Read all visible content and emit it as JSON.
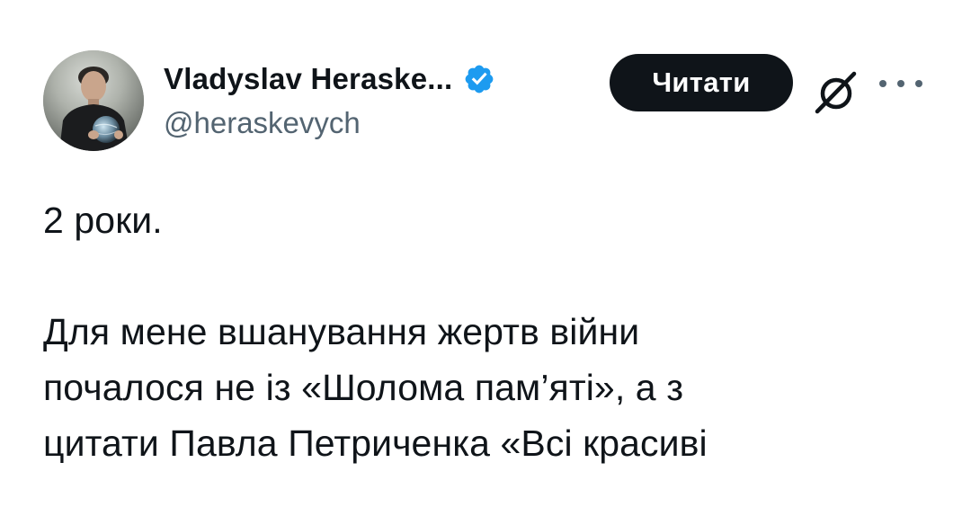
{
  "author": {
    "display_name": "Vladyslav Heraske...",
    "handle": "@heraskevych",
    "verified": true
  },
  "actions": {
    "follow_label": "Читати"
  },
  "tweet": {
    "paragraph_1": "2 роки.",
    "paragraph_2": "Для мене вшанування жертв війни\nпочалося не із «Шолома пам’яті», а з\nцитати Павла Петриченка «Всі красиві"
  },
  "icons": {
    "verified": "verified-badge-icon",
    "grok": "grok-icon",
    "more": "more-options-icon"
  },
  "colors": {
    "text_primary": "#0f1419",
    "text_secondary": "#536471",
    "verified_blue": "#1d9bf0",
    "button_bg": "#0f1419",
    "button_text": "#ffffff",
    "background": "#ffffff"
  }
}
